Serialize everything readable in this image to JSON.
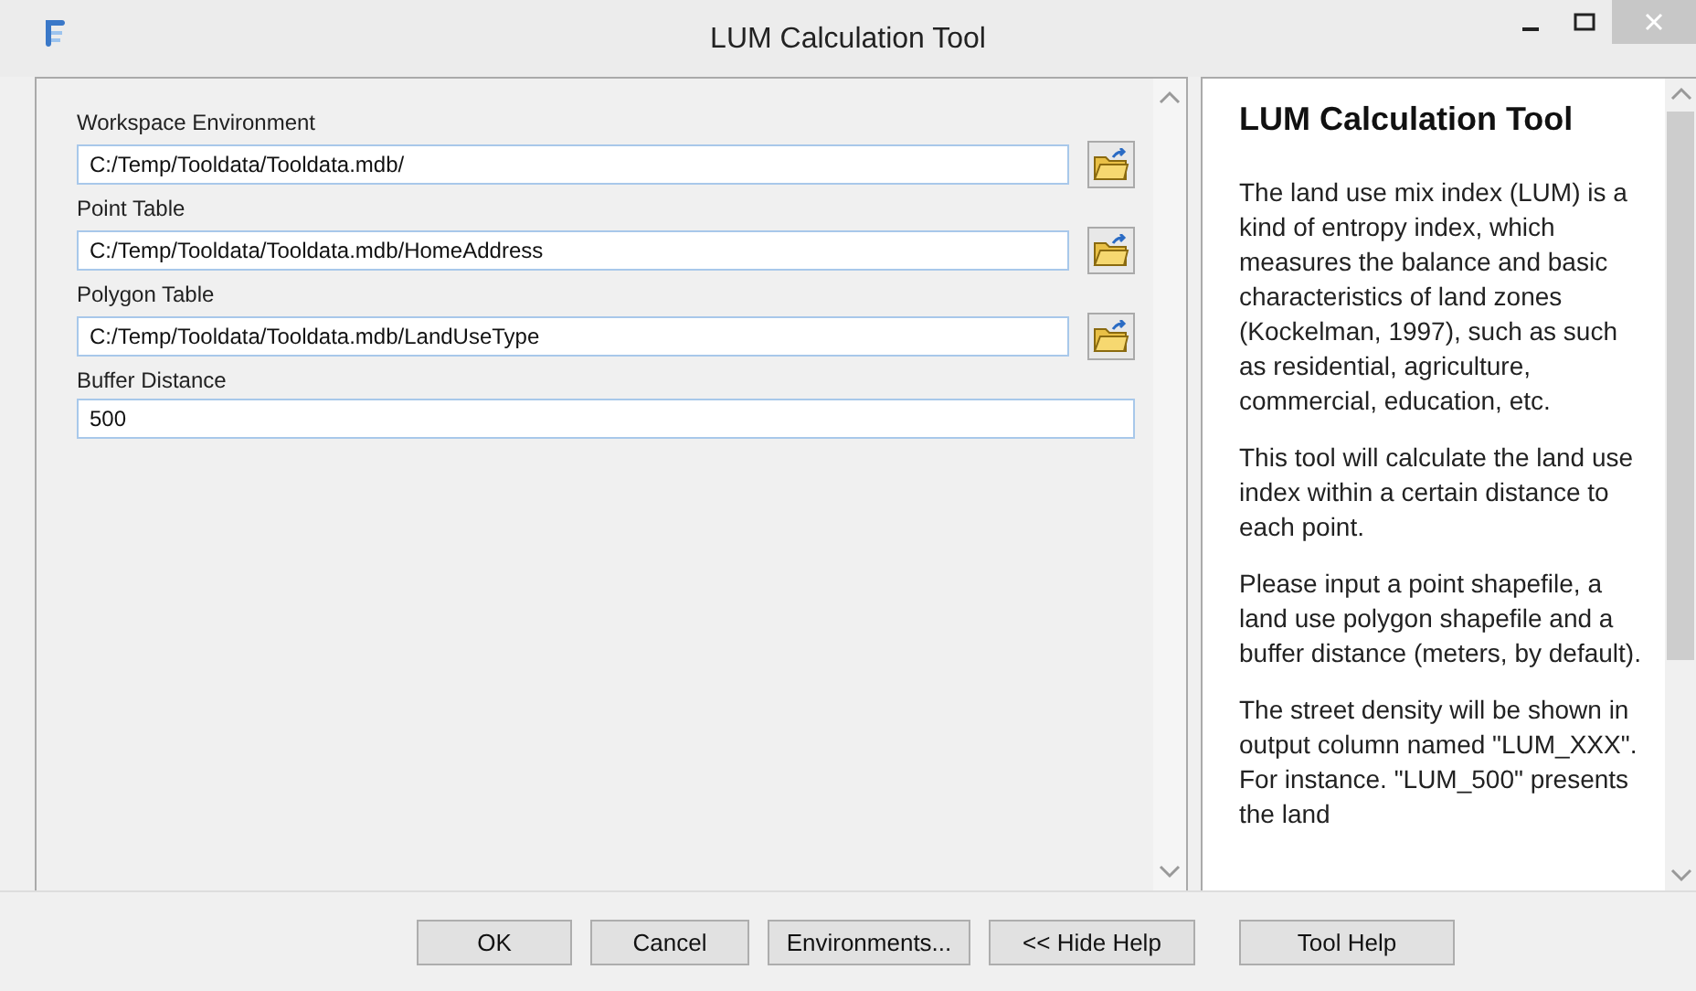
{
  "window": {
    "title": "LUM Calculation Tool"
  },
  "parameters": [
    {
      "label": "Workspace Environment",
      "value": "C:/Temp/Tooldata/Tooldata.mdb/",
      "browse": true
    },
    {
      "label": "Point Table",
      "value": "C:/Temp/Tooldata/Tooldata.mdb/HomeAddress",
      "browse": true
    },
    {
      "label": "Polygon Table",
      "value": "C:/Temp/Tooldata/Tooldata.mdb/LandUseType",
      "browse": true
    },
    {
      "label": "Buffer Distance",
      "value": "500",
      "browse": false
    }
  ],
  "help": {
    "title": "LUM Calculation Tool",
    "paragraphs": [
      "The land use mix index (LUM) is a kind of entropy index, which measures the balance and basic characteristics of land zones (Kockelman, 1997), such as such as residential, agriculture, commercial, education, etc.",
      "This tool will calculate the land use index within a certain distance to each point.",
      "Please input a point shapefile, a land use polygon shapefile and a buffer distance (meters, by default).",
      "The street density will be shown in output column named \"LUM_XXX\". For instance. \"LUM_500\" presents the land"
    ]
  },
  "buttons": [
    "OK",
    "Cancel",
    "Environments...",
    "<< Hide Help",
    "Tool Help"
  ]
}
